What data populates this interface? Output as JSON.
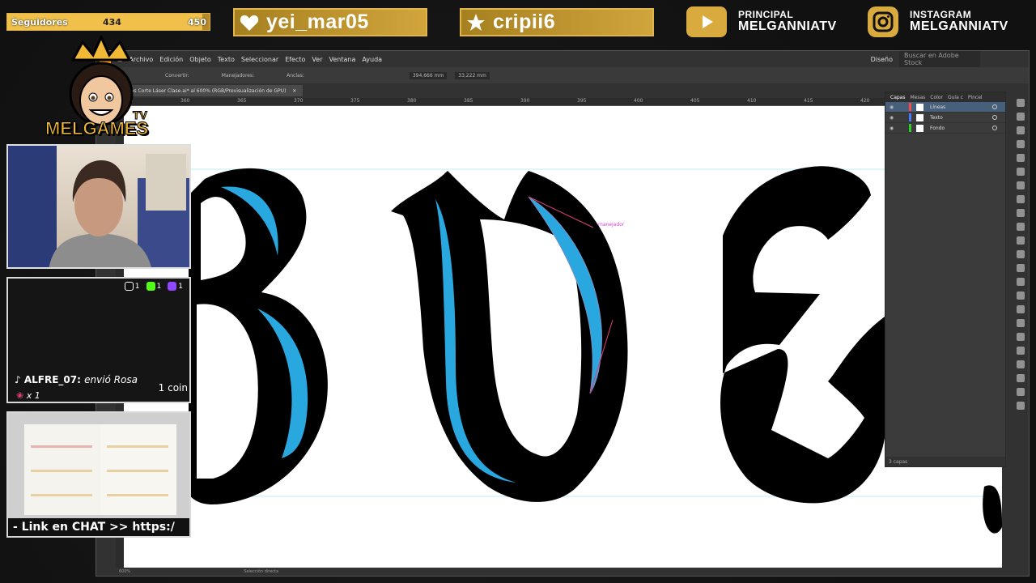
{
  "overlay": {
    "followers": {
      "label": "Seguidores",
      "current": "434",
      "goal": "450",
      "progress": 0.964
    },
    "pill1": {
      "icon": "heart-icon",
      "name": "yei_mar05"
    },
    "pill2": {
      "icon": "star-icon",
      "name": "cripii6"
    },
    "youtube": {
      "icon": "youtube-icon",
      "line1": "PRINCIPAL",
      "line2": "MELGANNIATV"
    },
    "instagram": {
      "icon": "instagram-icon",
      "line1": "INSTAGRAM",
      "line2": "MELGANNIATV"
    },
    "logo": "MELGAMES",
    "logo_tv": "TV"
  },
  "alerts": {
    "tiktok_count": "1",
    "kick_count": "1",
    "twitch_count": "1",
    "gift_user": "ALFRE_07:",
    "gift_text": "envió Rosa",
    "gift_coin": "1 coin",
    "gift_times": "x 1"
  },
  "product": {
    "link_text": "- Link en CHAT >> https:/"
  },
  "illustrator": {
    "menu": [
      "Archivo",
      "Edición",
      "Objeto",
      "Texto",
      "Seleccionar",
      "Efecto",
      "Ver",
      "Ventana",
      "Ayuda"
    ],
    "workspace": "Diseño",
    "stock_search_placeholder": "Buscar en Adobe Stock",
    "toolbar": {
      "convert": "Convertir:",
      "handles": "Manejadores:",
      "anchors": "Anclas:",
      "x_value": "394,666 mm",
      "y_value": "33,222 mm"
    },
    "doc_tab": "tras Corte Láser Clase.ai* al 600% (RGB/Previsualización de GPU)",
    "ruler": [
      "355",
      "360",
      "365",
      "370",
      "375",
      "380",
      "385",
      "390",
      "395",
      "400",
      "405",
      "410",
      "415",
      "420"
    ],
    "layers_panel": {
      "tabs": [
        "Capas",
        "Mesas",
        "Color",
        "Guía c",
        "Pincel"
      ],
      "layers": [
        {
          "name": "Líneas",
          "color": "#ff4a4a",
          "selected": true
        },
        {
          "name": "Texto",
          "color": "#4a7cff",
          "selected": false
        },
        {
          "name": "Fondo",
          "color": "#2bcc2b",
          "selected": false
        }
      ],
      "footer": "3 capas"
    },
    "status": {
      "zoom": "600%",
      "tool": "Selección directa"
    },
    "canvas_hint": "manejador"
  }
}
